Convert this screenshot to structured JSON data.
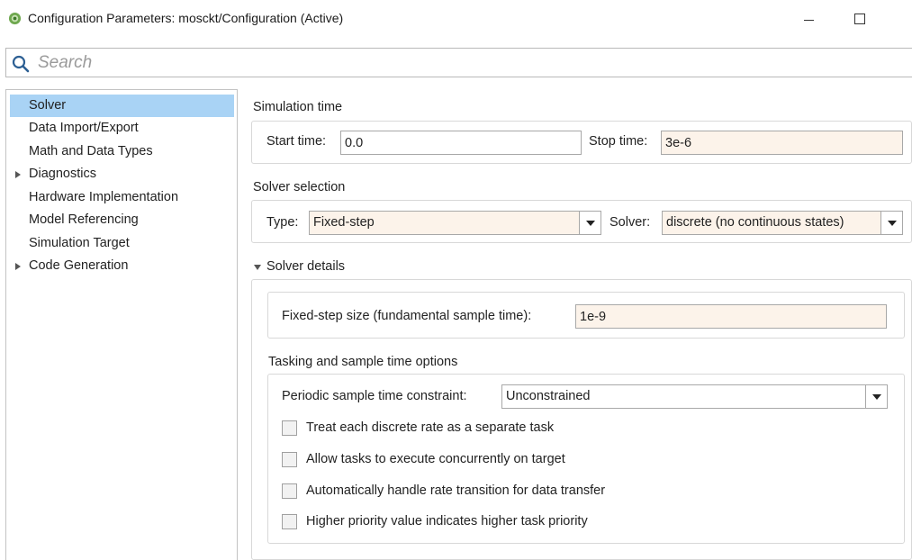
{
  "window": {
    "title": "Configuration Parameters: mosckt/Configuration (Active)",
    "icon": "simulink-config-icon"
  },
  "search": {
    "placeholder": "Search",
    "value": ""
  },
  "nav": {
    "items": [
      {
        "label": "Solver",
        "selected": true,
        "expandable": false
      },
      {
        "label": "Data Import/Export",
        "selected": false,
        "expandable": false
      },
      {
        "label": "Math and Data Types",
        "selected": false,
        "expandable": false
      },
      {
        "label": "Diagnostics",
        "selected": false,
        "expandable": true
      },
      {
        "label": "Hardware Implementation",
        "selected": false,
        "expandable": false
      },
      {
        "label": "Model Referencing",
        "selected": false,
        "expandable": false
      },
      {
        "label": "Simulation Target",
        "selected": false,
        "expandable": false
      },
      {
        "label": "Code Generation",
        "selected": false,
        "expandable": true
      }
    ]
  },
  "simulation_time": {
    "heading": "Simulation time",
    "start_label": "Start time:",
    "start_value": "0.0",
    "stop_label": "Stop time:",
    "stop_value": "3e-6"
  },
  "solver_selection": {
    "heading": "Solver selection",
    "type_label": "Type:",
    "type_value": "Fixed-step",
    "solver_label": "Solver:",
    "solver_value": "discrete (no continuous states)"
  },
  "solver_details": {
    "heading": "Solver details",
    "step_size_label": "Fixed-step size (fundamental sample time):",
    "step_size_value": "1e-9"
  },
  "tasking": {
    "heading": "Tasking and sample time options",
    "periodic_label": "Periodic sample time constraint:",
    "periodic_value": "Unconstrained",
    "checkboxes": [
      {
        "label": "Treat each discrete rate as a separate task",
        "checked": false
      },
      {
        "label": "Allow tasks to execute concurrently on target",
        "checked": false
      },
      {
        "label": "Automatically handle rate transition for data transfer",
        "checked": false
      },
      {
        "label": "Higher priority value indicates higher task priority",
        "checked": false
      }
    ]
  },
  "colors": {
    "selection": "#a9d3f5",
    "edited_field": "#fcf3ea",
    "border": "#a8a8a8"
  }
}
